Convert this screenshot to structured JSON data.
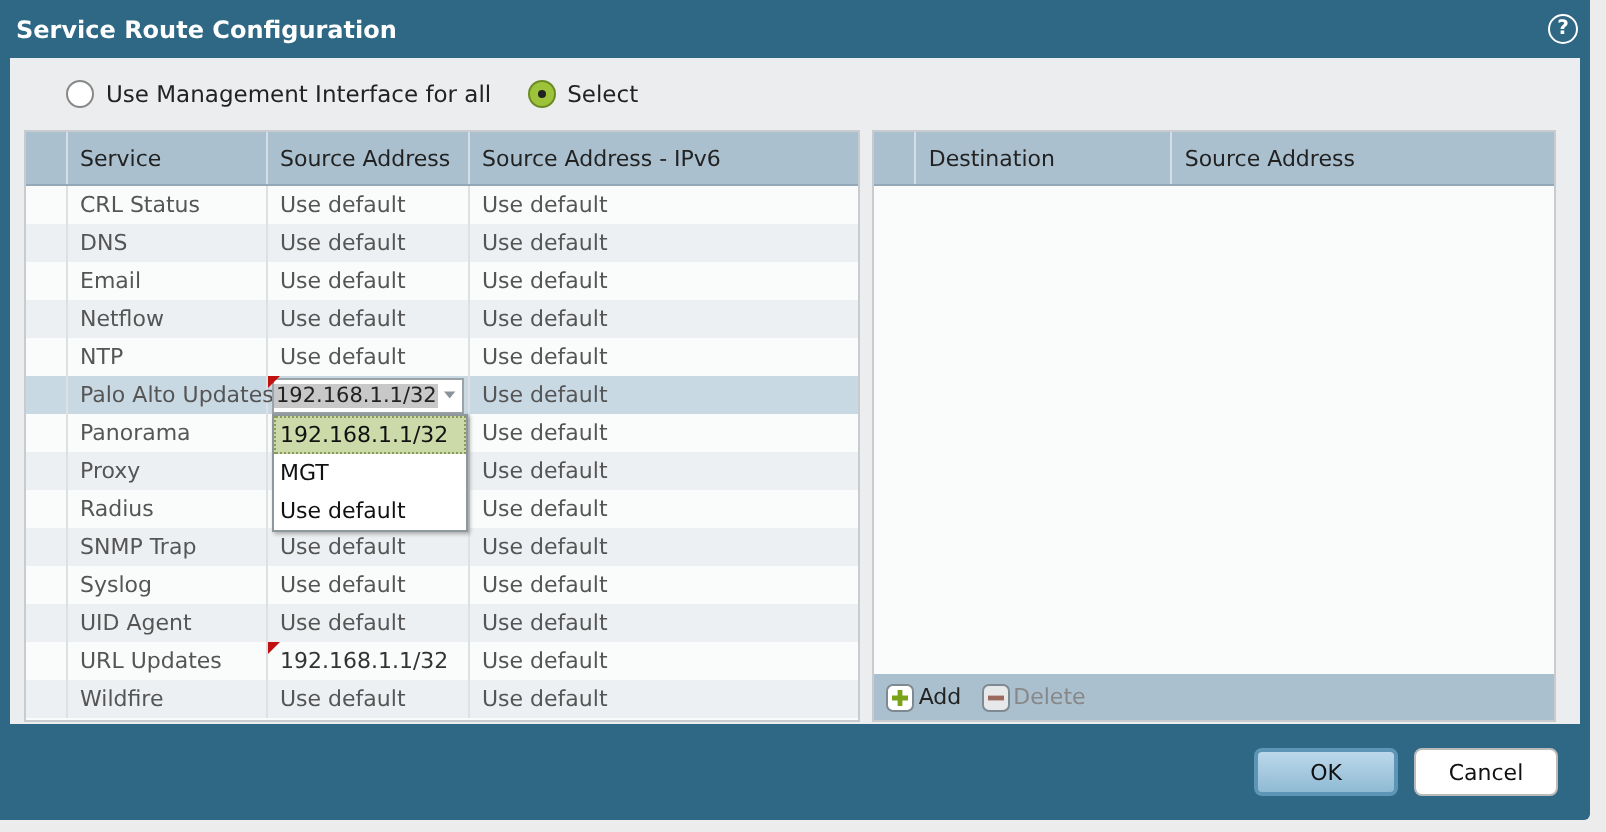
{
  "window": {
    "title": "Service Route Configuration",
    "help": "?"
  },
  "mode": [
    {
      "label": "Use Management Interface for all",
      "selected": false
    },
    {
      "label": "Select",
      "selected": true
    }
  ],
  "services_table": {
    "columns": [
      "Service",
      "Source Address",
      "Source Address - IPv6"
    ],
    "rows": [
      {
        "service": "CRL Status",
        "source": "Use default",
        "ipv6": "Use default",
        "selected": false,
        "modified": false
      },
      {
        "service": "DNS",
        "source": "Use default",
        "ipv6": "Use default",
        "selected": false,
        "modified": false
      },
      {
        "service": "Email",
        "source": "Use default",
        "ipv6": "Use default",
        "selected": false,
        "modified": false
      },
      {
        "service": "Netflow",
        "source": "Use default",
        "ipv6": "Use default",
        "selected": false,
        "modified": false
      },
      {
        "service": "NTP",
        "source": "Use default",
        "ipv6": "Use default",
        "selected": false,
        "modified": false
      },
      {
        "service": "Palo Alto Updates",
        "source": "192.168.1.1/32",
        "ipv6": "Use default",
        "selected": true,
        "modified": true,
        "editing": true
      },
      {
        "service": "Panorama",
        "ipv6": "Use default",
        "selected": false,
        "modified": false
      },
      {
        "service": "Proxy",
        "ipv6": "Use default",
        "selected": false,
        "modified": false
      },
      {
        "service": "Radius",
        "ipv6": "Use default",
        "selected": false,
        "modified": false
      },
      {
        "service": "SNMP Trap",
        "source": "Use default",
        "ipv6": "Use default",
        "selected": false,
        "modified": false
      },
      {
        "service": "Syslog",
        "source": "Use default",
        "ipv6": "Use default",
        "selected": false,
        "modified": false
      },
      {
        "service": "UID Agent",
        "source": "Use default",
        "ipv6": "Use default",
        "selected": false,
        "modified": false
      },
      {
        "service": "URL Updates",
        "source": "192.168.1.1/32",
        "ipv6": "Use default",
        "selected": false,
        "modified": true
      },
      {
        "service": "Wildfire",
        "source": "Use default",
        "ipv6": "Use default",
        "selected": false,
        "modified": false
      }
    ],
    "dropdown_options": [
      {
        "label": "192.168.1.1/32",
        "selected": true
      },
      {
        "label": "MGT",
        "selected": false
      },
      {
        "label": "Use default",
        "selected": false
      }
    ]
  },
  "destination_table": {
    "columns": [
      "Destination",
      "Source Address"
    ],
    "actions": [
      {
        "label": "Add",
        "kind": "add",
        "disabled": false
      },
      {
        "label": "Delete",
        "kind": "delete",
        "disabled": true
      }
    ]
  },
  "buttons": [
    {
      "label": "OK",
      "primary": true
    },
    {
      "label": "Cancel",
      "primary": false
    }
  ]
}
